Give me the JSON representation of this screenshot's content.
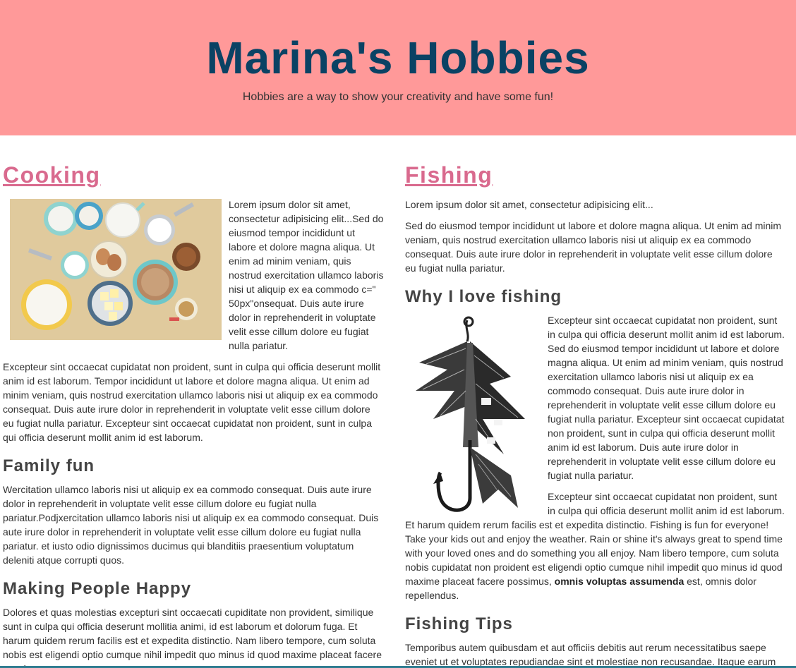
{
  "header": {
    "title": "Marina's Hobbies",
    "tagline": "Hobbies are a way to show your creativity and have some fun!"
  },
  "cooking": {
    "heading": "Cooking",
    "intro": "Lorem ipsum dolor sit amet, consectetur adipisicing elit...Sed do eiusmod tempor incididunt ut labore et dolore magna aliqua. Ut enim ad minim veniam, quis nostrud exercitation ullamco laboris nisi ut aliquip ex ea commodo c=\" 50px\"onsequat. Duis aute irure dolor in reprehenderit in voluptate velit esse cillum dolore eu fugiat nulla pariatur.",
    "paragraph2": "Excepteur sint occaecat cupidatat non proident, sunt in culpa qui officia deserunt mollit anim id est laborum. Tempor incididunt ut labore et dolore magna aliqua. Ut enim ad minim veniam, quis nostrud exercitation ullamco laboris nisi ut aliquip ex ea commodo consequat. Duis aute irure dolor in reprehenderit in voluptate velit esse cillum dolore eu fugiat nulla pariatur. Excepteur sint occaecat cupidatat non proident, sunt in culpa qui officia deserunt mollit anim id est laborum.",
    "family_heading": "Family fun",
    "family_text": "Wercitation ullamco laboris nisi ut aliquip ex ea commodo consequat. Duis aute irure dolor in reprehenderit in voluptate velit esse cillum dolore eu fugiat nulla pariatur.Podjxercitation ullamco laboris nisi ut aliquip ex ea commodo consequat. Duis aute irure dolor in reprehenderit in voluptate velit esse cillum dolore eu fugiat nulla pariatur. et iusto odio dignissimos ducimus qui blanditiis praesentium voluptatum deleniti atque corrupti quos.",
    "happy_heading": "Making People Happy",
    "happy_text": "Dolores et quas molestias excepturi sint occaecati cupiditate non provident, similique sunt in culpa qui officia deserunt mollitia animi, id est laborum et dolorum fuga. Et harum quidem rerum facilis est et expedita distinctio. Nam libero tempore, cum soluta nobis est eligendi optio cumque nihil impedit quo minus id quod maxime placeat facere possimus."
  },
  "fishing": {
    "heading": "Fishing",
    "intro": "Lorem ipsum dolor sit amet, consectetur adipisicing elit...",
    "paragraph2": "Sed do eiusmod tempor incididunt ut labore et dolore magna aliqua. Ut enim ad minim veniam, quis nostrud exercitation ullamco laboris nisi ut aliquip ex ea commodo consequat. Duis aute irure dolor in reprehenderit in voluptate velit esse cillum dolore eu fugiat nulla pariatur.",
    "why_heading": "Why I love fishing",
    "why_text": "Excepteur sint occaecat cupidatat non proident, sunt in culpa qui officia deserunt mollit anim id est laborum. Sed do eiusmod tempor incididunt ut labore et dolore magna aliqua. Ut enim ad minim veniam, quis nostrud exercitation ullamco laboris nisi ut aliquip ex ea commodo consequat. Duis aute irure dolor in reprehenderit in voluptate velit esse cillum dolore eu fugiat nulla pariatur. Excepteur sint occaecat cupidatat non proident, sunt in culpa qui officia deserunt mollit anim id est laborum. Duis aute irure dolor in reprehenderit in voluptate velit esse cillum dolore eu fugiat nulla pariatur.",
    "fun_text_before": "Excepteur sint occaecat cupidatat non proident, sunt in culpa qui officia deserunt mollit anim id est laborum. Et harum quidem rerum facilis est et expedita distinctio. Fishing is fun for everyone! Take your kids out and enjoy the weather. Rain or shine it's always great to spend time with your loved ones and do something you all enjoy. Nam libero tempore, cum soluta nobis cupidatat non proident est eligendi optio cumque nihil impedit quo minus id quod maxime placeat facere possimus, ",
    "fun_text_bold": "omnis voluptas assumenda",
    "fun_text_after": " est, omnis dolor repellendus.",
    "tips_heading": "Fishing Tips",
    "tips_text": "Temporibus autem quibusdam et aut officiis debitis aut rerum necessitatibus saepe eveniet ut et voluptates repudiandae sint et molestiae non recusandae. Itaque earum rerum hic tenetur a sapiente delectus."
  },
  "colors": {
    "header_bg": "#ff9999",
    "title": "#0a4264",
    "section_heading": "#d96a8e",
    "accent_line": "#2f7d91"
  }
}
